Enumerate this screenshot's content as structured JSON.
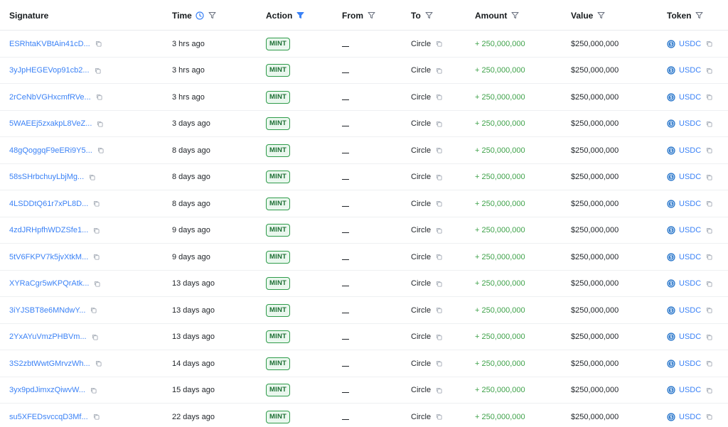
{
  "columns": {
    "signature": "Signature",
    "time": "Time",
    "action": "Action",
    "from": "From",
    "to": "To",
    "amount": "Amount",
    "value": "Value",
    "token": "Token"
  },
  "colors": {
    "link": "#3b82f6",
    "amount_positive": "#3fa24a",
    "mint_border": "#2e9b4a",
    "mint_bg": "#eaf7ee",
    "active_filter": "#3b82f6"
  },
  "active_filter_column": "Action",
  "rows": [
    {
      "signature": "ESRhtaKVBtAin41cD...",
      "time": "3 hrs ago",
      "action": "MINT",
      "from": "",
      "to": "Circle",
      "amount": "+ 250,000,000",
      "value": "$250,000,000",
      "token": "USDC"
    },
    {
      "signature": "3yJpHEGEVop91cb2...",
      "time": "3 hrs ago",
      "action": "MINT",
      "from": "",
      "to": "Circle",
      "amount": "+ 250,000,000",
      "value": "$250,000,000",
      "token": "USDC"
    },
    {
      "signature": "2rCeNbVGHxcmfRVe...",
      "time": "3 hrs ago",
      "action": "MINT",
      "from": "",
      "to": "Circle",
      "amount": "+ 250,000,000",
      "value": "$250,000,000",
      "token": "USDC"
    },
    {
      "signature": "5WAEEj5zxakpL8VeZ...",
      "time": "3 days ago",
      "action": "MINT",
      "from": "",
      "to": "Circle",
      "amount": "+ 250,000,000",
      "value": "$250,000,000",
      "token": "USDC"
    },
    {
      "signature": "48gQoggqF9eERi9Y5...",
      "time": "8 days ago",
      "action": "MINT",
      "from": "",
      "to": "Circle",
      "amount": "+ 250,000,000",
      "value": "$250,000,000",
      "token": "USDC"
    },
    {
      "signature": "58sSHrbchuyLbjMg...",
      "time": "8 days ago",
      "action": "MINT",
      "from": "",
      "to": "Circle",
      "amount": "+ 250,000,000",
      "value": "$250,000,000",
      "token": "USDC"
    },
    {
      "signature": "4LSDDtQ61r7xPL8D...",
      "time": "8 days ago",
      "action": "MINT",
      "from": "",
      "to": "Circle",
      "amount": "+ 250,000,000",
      "value": "$250,000,000",
      "token": "USDC"
    },
    {
      "signature": "4zdJRHpfhWDZSfe1...",
      "time": "9 days ago",
      "action": "MINT",
      "from": "",
      "to": "Circle",
      "amount": "+ 250,000,000",
      "value": "$250,000,000",
      "token": "USDC"
    },
    {
      "signature": "5tV6FKPV7k5jvXtkM...",
      "time": "9 days ago",
      "action": "MINT",
      "from": "",
      "to": "Circle",
      "amount": "+ 250,000,000",
      "value": "$250,000,000",
      "token": "USDC"
    },
    {
      "signature": "XYRaCgr5wKPQrAtk...",
      "time": "13 days ago",
      "action": "MINT",
      "from": "",
      "to": "Circle",
      "amount": "+ 250,000,000",
      "value": "$250,000,000",
      "token": "USDC"
    },
    {
      "signature": "3iYJSBT8e6MNdwY...",
      "time": "13 days ago",
      "action": "MINT",
      "from": "",
      "to": "Circle",
      "amount": "+ 250,000,000",
      "value": "$250,000,000",
      "token": "USDC"
    },
    {
      "signature": "2YxAYuVmzPHBVm...",
      "time": "13 days ago",
      "action": "MINT",
      "from": "",
      "to": "Circle",
      "amount": "+ 250,000,000",
      "value": "$250,000,000",
      "token": "USDC"
    },
    {
      "signature": "3S2zbtWwtGMrvzWh...",
      "time": "14 days ago",
      "action": "MINT",
      "from": "",
      "to": "Circle",
      "amount": "+ 250,000,000",
      "value": "$250,000,000",
      "token": "USDC"
    },
    {
      "signature": "3yx9pdJimxzQiwvW...",
      "time": "15 days ago",
      "action": "MINT",
      "from": "",
      "to": "Circle",
      "amount": "+ 250,000,000",
      "value": "$250,000,000",
      "token": "USDC"
    },
    {
      "signature": "su5XFEDsvccqD3Mf...",
      "time": "22 days ago",
      "action": "MINT",
      "from": "",
      "to": "Circle",
      "amount": "+ 250,000,000",
      "value": "$250,000,000",
      "token": "USDC"
    }
  ]
}
